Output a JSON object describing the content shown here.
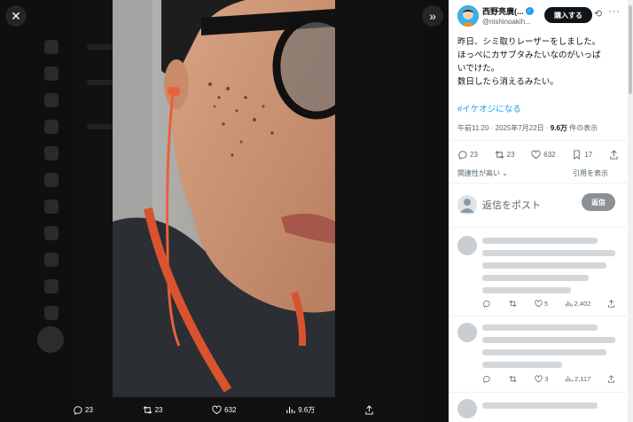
{
  "viewer": {
    "close_icon": "close-icon",
    "collapse_icon": "double-chevron-right-icon"
  },
  "bottom_bar": {
    "replies": "23",
    "reposts": "23",
    "likes": "632",
    "views": "9.6万"
  },
  "post": {
    "display_name": "西野亮廣(...",
    "handle": "@nishinoakih...",
    "subscribe_label": "購入する",
    "text": "昨日、シミ取りレーザーをしました。\nほっぺにカサブタみたいなのがいっぱ\nいでけた。\n数日したら消えるみたい。",
    "hashtag": "#イケオジになる",
    "timestamp": "午前11:20 · 2025年7月22日 · ",
    "views_count": "9.6万",
    "views_suffix": " 件の表示",
    "replies": "23",
    "reposts": "23",
    "likes": "632",
    "bookmarks": "17"
  },
  "sort": {
    "relevance_label": "関連性が高い",
    "view_label": "引用を表示"
  },
  "composer": {
    "placeholder": "返信をポスト",
    "reply_button": "返信"
  },
  "replies": [
    {
      "replies": "",
      "reposts": "",
      "likes": "5",
      "views": "2,402"
    },
    {
      "replies": "",
      "reposts": "",
      "likes": "3",
      "views": "2,117"
    }
  ],
  "colors": {
    "accent": "#1d9bf0",
    "verified": "#1d9bf0",
    "earphone_cord": "#e8613a"
  }
}
